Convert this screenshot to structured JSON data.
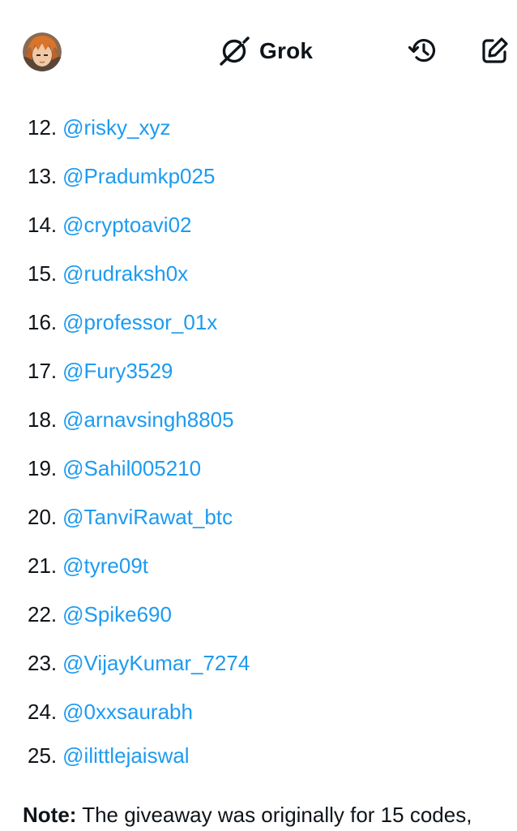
{
  "header": {
    "brand_name": "Grok",
    "avatar_alt": "profile avatar"
  },
  "list": [
    {
      "num": "12.",
      "handle": "@risky_xyz"
    },
    {
      "num": "13.",
      "handle": "@Pradumkp025"
    },
    {
      "num": "14.",
      "handle": "@cryptoavi02"
    },
    {
      "num": "15.",
      "handle": "@rudraksh0x"
    },
    {
      "num": "16.",
      "handle": "@professor_01x"
    },
    {
      "num": "17.",
      "handle": "@Fury3529"
    },
    {
      "num": "18.",
      "handle": "@arnavsingh8805"
    },
    {
      "num": "19.",
      "handle": "@Sahil005210"
    },
    {
      "num": "20.",
      "handle": "@TanviRawat_btc"
    },
    {
      "num": "21.",
      "handle": "@tyre09t"
    },
    {
      "num": "22.",
      "handle": "@Spike690"
    },
    {
      "num": "23.",
      "handle": "@VijayKumar_7274"
    },
    {
      "num": "24.",
      "handle": "@0xxsaurabh"
    },
    {
      "num": "25.",
      "handle": "@ilittlejaiswal"
    }
  ],
  "note": {
    "label": "Note:",
    "text": " The giveaway was originally for 15 codes,"
  },
  "colors": {
    "link": "#1d9bf0",
    "text": "#0f1419",
    "background": "#ffffff"
  }
}
